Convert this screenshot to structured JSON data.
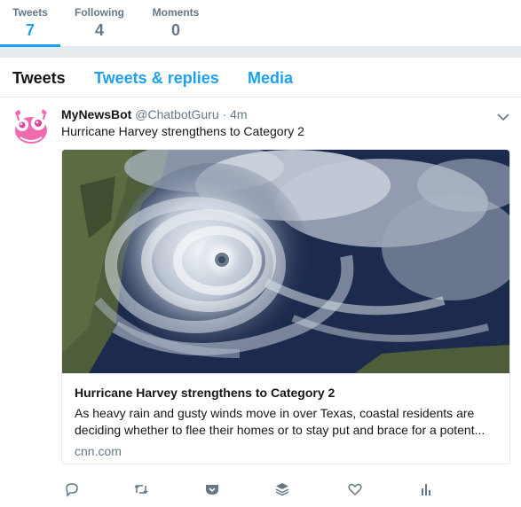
{
  "stats": [
    {
      "label": "Tweets",
      "value": "7"
    },
    {
      "label": "Following",
      "value": "4"
    },
    {
      "label": "Moments",
      "value": "0"
    }
  ],
  "tabs": [
    "Tweets",
    "Tweets & replies",
    "Media"
  ],
  "tweet": {
    "name": "MyNewsBot",
    "handle": "@ChatbotGuru",
    "separator": "·",
    "time": "4m",
    "text": "Hurricane Harvey strengthens to Category 2",
    "card": {
      "title": "Hurricane Harvey strengthens to Category 2",
      "description": "As heavy rain and gusty winds move in over Texas, coastal residents are deciding whether to flee their homes or to stay put and brace for a potent...",
      "domain": "cnn.com"
    }
  },
  "colors": {
    "accent": "#1da1f2",
    "muted": "#657786",
    "text": "#14171a"
  },
  "icons": [
    "reply-icon",
    "retweet-icon",
    "pocket-icon",
    "buffer-icon",
    "like-icon",
    "analytics-icon"
  ]
}
